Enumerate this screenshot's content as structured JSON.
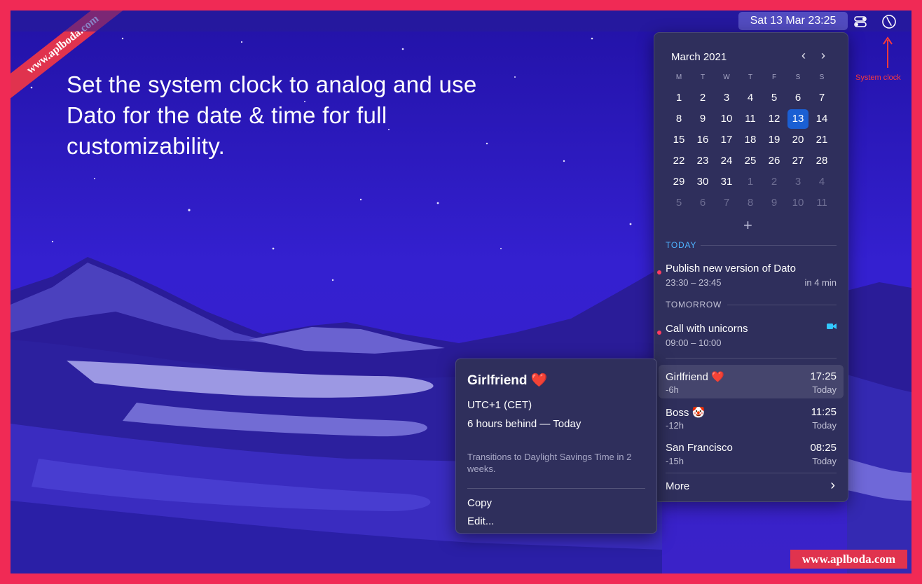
{
  "watermark": {
    "corner": "www.aplboda.com",
    "bottom_right": "www.aplboda.com"
  },
  "menubar": {
    "datetime": "Sat 13 Mar  23:25",
    "control_icon": "control-center-icon",
    "clock_icon": "analog-clock-icon"
  },
  "headline": "Set the system clock to analog and use Dato for the date & time for full customizability.",
  "annotation": {
    "label": "System clock",
    "color": "#ff3b3b"
  },
  "calendar": {
    "month_label": "March 2021",
    "prev": "‹",
    "next": "›",
    "weekdays": [
      "M",
      "T",
      "W",
      "T",
      "F",
      "S",
      "S"
    ],
    "weeks": [
      [
        "1",
        "2",
        "3",
        "4",
        "5",
        "6",
        "7"
      ],
      [
        "8",
        "9",
        "10",
        "11",
        "12",
        "13",
        "14"
      ],
      [
        "15",
        "16",
        "17",
        "18",
        "19",
        "20",
        "21"
      ],
      [
        "22",
        "23",
        "24",
        "25",
        "26",
        "27",
        "28"
      ],
      [
        "29",
        "30",
        "31",
        "1",
        "2",
        "3",
        "4"
      ],
      [
        "5",
        "6",
        "7",
        "8",
        "9",
        "10",
        "11"
      ]
    ],
    "selected_day": "13",
    "add_label": "+"
  },
  "today": {
    "label": "TODAY",
    "event": {
      "title": "Publish new version of Dato",
      "time": "23:30 – 23:45",
      "relative": "in 4 min"
    }
  },
  "tomorrow": {
    "label": "TOMORROW",
    "event": {
      "title": "Call with unicorns",
      "time": "09:00 – 10:00"
    }
  },
  "timezones": [
    {
      "name": "Girlfriend ❤️",
      "offset": "-6h",
      "time": "17:25",
      "day": "Today"
    },
    {
      "name": "Boss 🤡",
      "offset": "-12h",
      "time": "11:25",
      "day": "Today"
    },
    {
      "name": "San Francisco",
      "offset": "-15h",
      "time": "08:25",
      "day": "Today"
    }
  ],
  "more": {
    "label": "More",
    "chevron": "›"
  },
  "popover": {
    "title": "Girlfriend ❤️",
    "zone": "UTC+1 (CET)",
    "difference": "6 hours behind — Today",
    "note": "Transitions to Daylight Savings Time in 2 weeks.",
    "actions": [
      "Copy",
      "Edit..."
    ]
  },
  "colors": {
    "accent": "#1a5fd3",
    "today_label": "#4fb3ff",
    "event_dot": "#ff3b62",
    "video": "#32c8ff"
  }
}
